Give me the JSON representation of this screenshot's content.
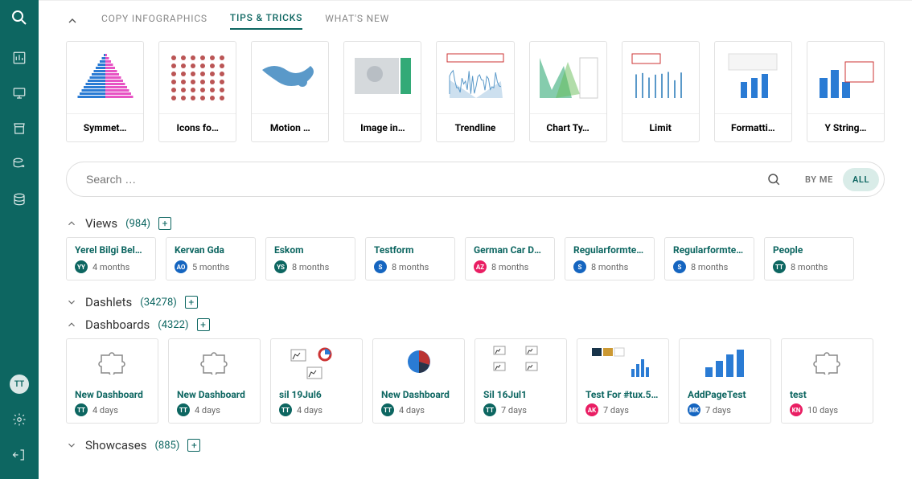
{
  "tabs": {
    "copy_infographics": "COPY INFOGRAPHICS",
    "tips_tricks": "TIPS & TRICKS",
    "whats_new": "WHAT'S NEW"
  },
  "tip_cards": [
    {
      "label": "Symmet…"
    },
    {
      "label": "Icons fo…"
    },
    {
      "label": "Motion …"
    },
    {
      "label": "Image in…"
    },
    {
      "label": "Trendline"
    },
    {
      "label": "Chart Ty…"
    },
    {
      "label": "Limit"
    },
    {
      "label": "Formatti…"
    },
    {
      "label": "Y String…"
    }
  ],
  "search": {
    "placeholder": "Search …",
    "by_me": "BY ME",
    "all": "ALL"
  },
  "sections": {
    "views": {
      "title": "Views",
      "count": "(984)"
    },
    "dashlets": {
      "title": "Dashlets",
      "count": "(34278)"
    },
    "dashboards": {
      "title": "Dashboards",
      "count": "(4322)"
    },
    "showcases": {
      "title": "Showcases",
      "count": "(885)"
    }
  },
  "views": [
    {
      "title": "Yerel Bilgi Bele…",
      "avatar": "YY",
      "color": "#0d6661",
      "time": "4 months"
    },
    {
      "title": "Kervan Gda",
      "avatar": "AO",
      "color": "#1565c0",
      "time": "5 months"
    },
    {
      "title": "Eskom",
      "avatar": "YS",
      "color": "#0d6661",
      "time": "8 months"
    },
    {
      "title": "Testform",
      "avatar": "S",
      "color": "#1565c0",
      "time": "8 months"
    },
    {
      "title": "German Car Da…",
      "avatar": "AZ",
      "color": "#e91e63",
      "time": "8 months"
    },
    {
      "title": "Regularformte…",
      "avatar": "S",
      "color": "#1565c0",
      "time": "8 months"
    },
    {
      "title": "Regularformte…",
      "avatar": "S",
      "color": "#1565c0",
      "time": "8 months"
    },
    {
      "title": "People",
      "avatar": "TT",
      "color": "#0d6661",
      "time": "8 months"
    }
  ],
  "dashboards": [
    {
      "title": "New Dashboard",
      "avatar": "TT",
      "color": "#0d6661",
      "time": "4 days",
      "thumb": "puzzle"
    },
    {
      "title": "New Dashboard",
      "avatar": "TT",
      "color": "#0d6661",
      "time": "4 days",
      "thumb": "puzzle"
    },
    {
      "title": "sil 19Jul6",
      "avatar": "TT",
      "color": "#0d6661",
      "time": "4 days",
      "thumb": "charts1"
    },
    {
      "title": "New Dashboard",
      "avatar": "TT",
      "color": "#0d6661",
      "time": "4 days",
      "thumb": "pie"
    },
    {
      "title": "Sil 16Jul1",
      "avatar": "TT",
      "color": "#0d6661",
      "time": "7 days",
      "thumb": "charts2"
    },
    {
      "title": "Test For #tux.5…",
      "avatar": "AK",
      "color": "#e91e63",
      "time": "7 days",
      "thumb": "mixed"
    },
    {
      "title": "AddPageTest",
      "avatar": "MK",
      "color": "#1565c0",
      "time": "7 days",
      "thumb": "bars"
    },
    {
      "title": "test",
      "avatar": "KN",
      "color": "#e91e63",
      "time": "10 days",
      "thumb": "puzzle"
    }
  ],
  "sidebar_avatar": "TT"
}
